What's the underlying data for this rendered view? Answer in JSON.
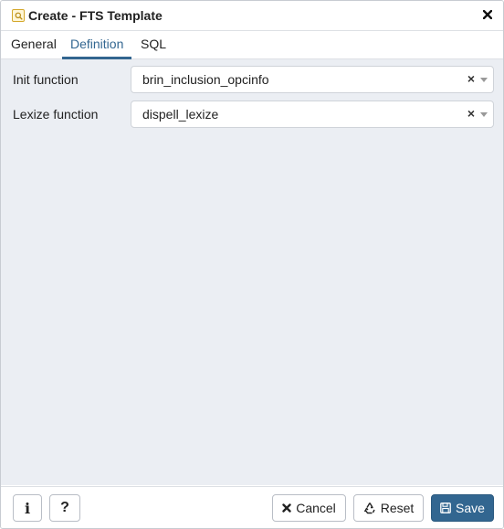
{
  "dialog": {
    "title": "Create - FTS Template",
    "title_icon": "fts-template-icon",
    "close_icon": "close-icon"
  },
  "tabs": [
    {
      "label": "General",
      "active": false
    },
    {
      "label": "Definition",
      "active": true
    },
    {
      "label": "SQL",
      "active": false
    }
  ],
  "form": {
    "init_function": {
      "label": "Init function",
      "value": "brin_inclusion_opcinfo"
    },
    "lexize_function": {
      "label": "Lexize function",
      "value": "dispell_lexize"
    }
  },
  "footer": {
    "info_glyph": "i",
    "help_glyph": "?",
    "cancel_label": "Cancel",
    "reset_label": "Reset",
    "save_label": "Save"
  },
  "colors": {
    "accent": "#326690",
    "content_bg": "#ebeef3"
  }
}
